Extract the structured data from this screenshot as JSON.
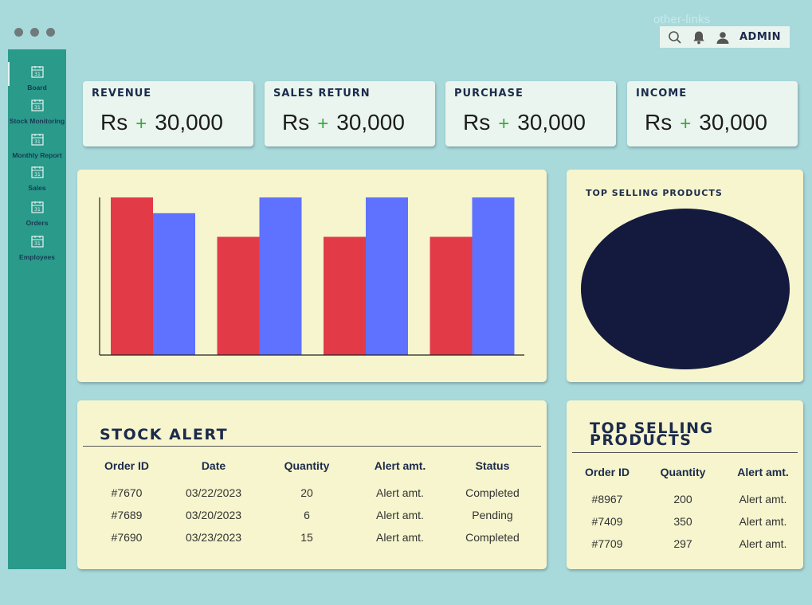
{
  "window": {
    "other_links": "other-links"
  },
  "topbar": {
    "admin_label": "ADMIN",
    "icons": [
      "search-icon",
      "bell-icon",
      "user-icon"
    ]
  },
  "sidebar": {
    "items": [
      {
        "label": "Board",
        "icon": "calendar-icon"
      },
      {
        "label": "Stock Monitoring",
        "icon": "calendar-icon"
      },
      {
        "label": "Monthly Report",
        "icon": "calendar-icon"
      },
      {
        "label": "Sales",
        "icon": "calendar-icon"
      },
      {
        "label": "Orders",
        "icon": "calendar-icon"
      },
      {
        "label": "Employees",
        "icon": "calendar-icon"
      }
    ]
  },
  "kpis": [
    {
      "title": "Revenue",
      "currency": "Rs",
      "sign": "+",
      "value": "30,000"
    },
    {
      "title": "Sales Return",
      "currency": "Rs",
      "sign": "+",
      "value": "30,000"
    },
    {
      "title": "Purchase",
      "currency": "Rs",
      "sign": "+",
      "value": "30,000"
    },
    {
      "title": "Income",
      "currency": "Rs",
      "sign": "+",
      "value": "30,000"
    }
  ],
  "chart_data": {
    "type": "bar",
    "categories": [
      "",
      "",
      "",
      ""
    ],
    "series": [
      {
        "values": [
          100,
          75,
          75,
          75
        ],
        "color": "#e33a48"
      },
      {
        "values": [
          90,
          100,
          100,
          100
        ],
        "color": "#5f72ff"
      }
    ],
    "ylim": [
      0,
      100
    ],
    "title": "",
    "xlabel": "",
    "ylabel": ""
  },
  "pie": {
    "title": "Top Selling Products",
    "color": "#141a3d"
  },
  "stock_alert": {
    "title": "Stock Alert",
    "columns": [
      "Order ID",
      "Date",
      "Quantity",
      "Alert amt.",
      "Status"
    ],
    "rows": [
      [
        "#7670",
        "03/22/2023",
        "20",
        "Alert amt.",
        "Completed"
      ],
      [
        "#7689",
        "03/20/2023",
        "6",
        "Alert amt.",
        "Pending"
      ],
      [
        "#7690",
        "03/23/2023",
        "15",
        "Alert amt.",
        "Completed"
      ]
    ]
  },
  "top_selling": {
    "title_line1": "Top Selling",
    "title_line2": "Products",
    "columns": [
      "Order ID",
      "Quantity",
      "Alert amt."
    ],
    "rows": [
      [
        "#8967",
        "200",
        "Alert amt."
      ],
      [
        "#7409",
        "350",
        "Alert amt."
      ],
      [
        "#7709",
        "297",
        "Alert amt."
      ]
    ]
  }
}
